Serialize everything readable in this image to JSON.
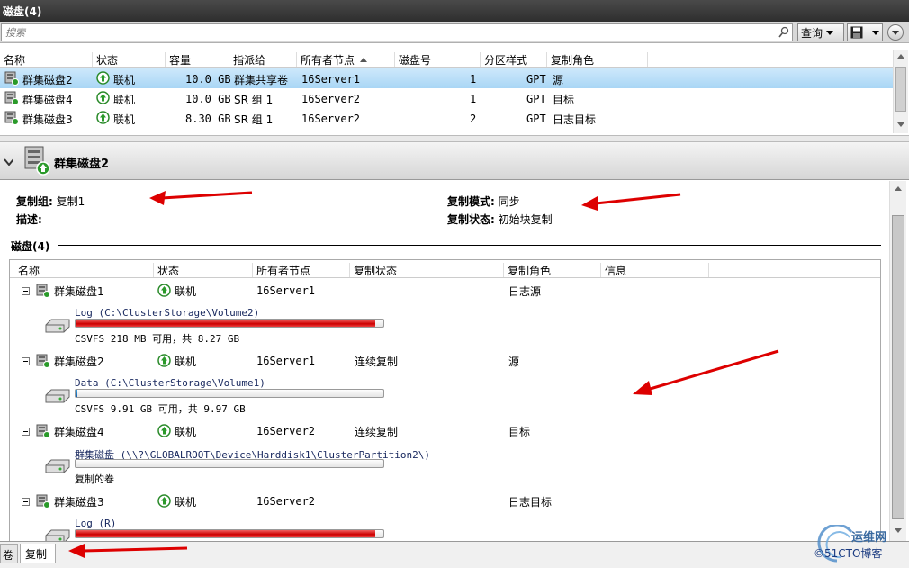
{
  "window": {
    "title": "磁盘(4)"
  },
  "search": {
    "placeholder": "搜索",
    "query_label": "查询"
  },
  "disks_table": {
    "columns": [
      "名称",
      "状态",
      "容量",
      "指派给",
      "所有者节点",
      "磁盘号",
      "分区样式",
      "复制角色"
    ],
    "rows": [
      {
        "name": "群集磁盘2",
        "status": "联机",
        "capacity": "10.0 GB",
        "assigned": "群集共享卷",
        "owner": "16Server1",
        "disk_no": "1",
        "partition": "GPT",
        "role": "源",
        "selected": true
      },
      {
        "name": "群集磁盘4",
        "status": "联机",
        "capacity": "10.0 GB",
        "assigned": "SR 组 1",
        "owner": "16Server2",
        "disk_no": "1",
        "partition": "GPT",
        "role": "目标",
        "selected": false
      },
      {
        "name": "群集磁盘3",
        "status": "联机",
        "capacity": "8.30 GB",
        "assigned": "SR 组 1",
        "owner": "16Server2",
        "disk_no": "2",
        "partition": "GPT",
        "role": "日志目标",
        "selected": false
      }
    ]
  },
  "detail": {
    "title": "群集磁盘2",
    "replication_group_label": "复制组:",
    "replication_group_value": "复制1",
    "description_label": "描述:",
    "replication_mode_label": "复制模式:",
    "replication_mode_value": "同步",
    "replication_status_label": "复制状态:",
    "replication_status_value": "初始块复制",
    "section_title": "磁盘(4)",
    "columns": [
      "名称",
      "状态",
      "所有者节点",
      "复制状态",
      "复制角色",
      "信息"
    ],
    "disks": [
      {
        "name": "群集磁盘1",
        "status": "联机",
        "owner": "16Server1",
        "repl_status": "",
        "role": "日志源",
        "volume_label": "Log (C:\\ClusterStorage\\Volume2)",
        "usage_fraction": 0.974,
        "volume_info": "CSVFS 218 MB 可用，共 8.27 GB"
      },
      {
        "name": "群集磁盘2",
        "status": "联机",
        "owner": "16Server1",
        "repl_status": "连续复制",
        "role": "源",
        "volume_label": "Data (C:\\ClusterStorage\\Volume1)",
        "usage_fraction": 0.006,
        "volume_info": "CSVFS 9.91 GB 可用，共 9.97 GB"
      },
      {
        "name": "群集磁盘4",
        "status": "联机",
        "owner": "16Server2",
        "repl_status": "连续复制",
        "role": "目标",
        "volume_label": "群集磁盘 (\\\\?\\GLOBALROOT\\Device\\Harddisk1\\ClusterPartition2\\)",
        "usage_fraction": 0,
        "volume_info": "复制的卷"
      },
      {
        "name": "群集磁盘3",
        "status": "联机",
        "owner": "16Server2",
        "repl_status": "",
        "role": "日志目标",
        "volume_label": "Log (R)",
        "usage_fraction": 0.974,
        "volume_info": ""
      }
    ]
  },
  "bottom_tabs": [
    "卷",
    "复制"
  ],
  "watermark": {
    "line1": "运维网",
    "line2": "©51CTO博客"
  },
  "colors": {
    "selection": "#a9d6f5",
    "usage_bar": "#cc0000",
    "arrow": "#dd0000"
  }
}
